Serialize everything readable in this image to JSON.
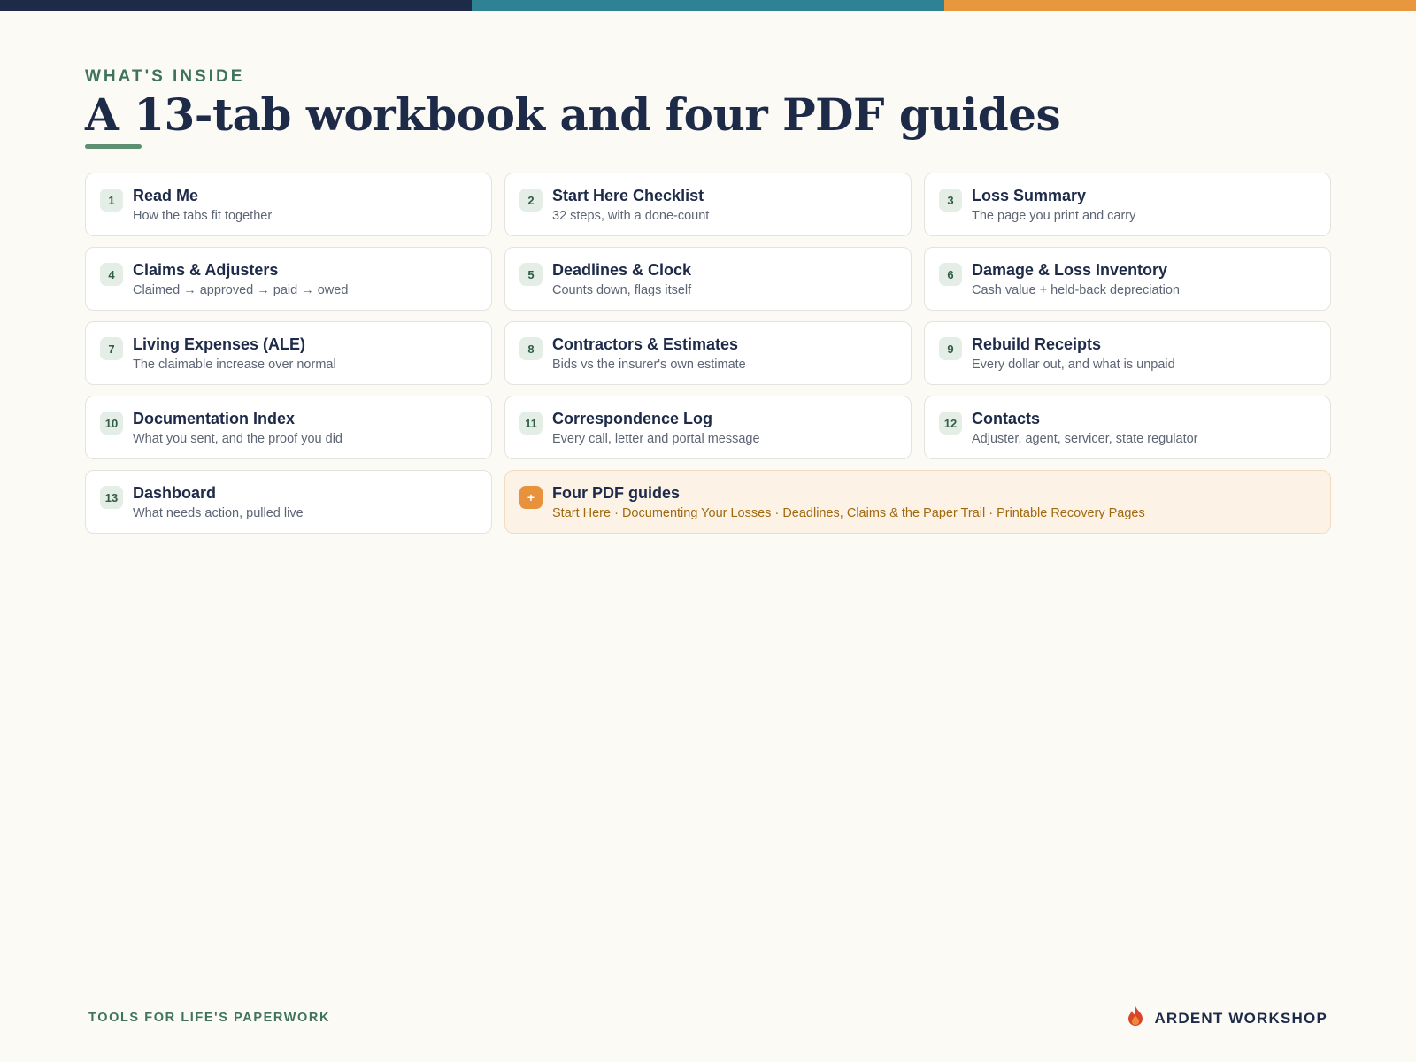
{
  "colors": {
    "topbar": [
      "#1d2a48",
      "#2e8294",
      "#e9973e"
    ],
    "accent_green": "#3f7458",
    "navy": "#1d2a48",
    "orange": "#e9923e"
  },
  "header": {
    "eyebrow": "WHAT'S INSIDE",
    "title": "A 13-tab workbook and four PDF guides"
  },
  "tabs": [
    {
      "num": "1",
      "name": "Read Me",
      "desc": "How the tabs fit together"
    },
    {
      "num": "2",
      "name": "Start Here Checklist",
      "desc": "32 steps, with a done-count"
    },
    {
      "num": "3",
      "name": "Loss Summary",
      "desc": "The page you print and carry"
    },
    {
      "num": "4",
      "name": "Claims & Adjusters",
      "desc": "Claimed → approved → paid → owed"
    },
    {
      "num": "5",
      "name": "Deadlines & Clock",
      "desc": "Counts down, flags itself"
    },
    {
      "num": "6",
      "name": "Damage & Loss Inventory",
      "desc": "Cash value + held-back depreciation"
    },
    {
      "num": "7",
      "name": "Living Expenses (ALE)",
      "desc": "The claimable increase over normal"
    },
    {
      "num": "8",
      "name": "Contractors & Estimates",
      "desc": "Bids vs the insurer's own estimate"
    },
    {
      "num": "9",
      "name": "Rebuild Receipts",
      "desc": "Every dollar out, and what is unpaid"
    },
    {
      "num": "10",
      "name": "Documentation Index",
      "desc": "What you sent, and the proof you did"
    },
    {
      "num": "11",
      "name": "Correspondence Log",
      "desc": "Every call, letter and portal message"
    },
    {
      "num": "12",
      "name": "Contacts",
      "desc": "Adjuster, agent, servicer, state regulator"
    },
    {
      "num": "13",
      "name": "Dashboard",
      "desc": "What needs action, pulled live"
    }
  ],
  "guides": {
    "badge": "+",
    "name": "Four PDF guides",
    "desc": "Start Here · Documenting Your Losses · Deadlines, Claims & the Paper Trail · Printable Recovery Pages"
  },
  "footer": {
    "tagline": "TOOLS FOR LIFE'S PAPERWORK",
    "brand": "ARDENT WORKSHOP",
    "logo_icon": "flame-icon"
  }
}
